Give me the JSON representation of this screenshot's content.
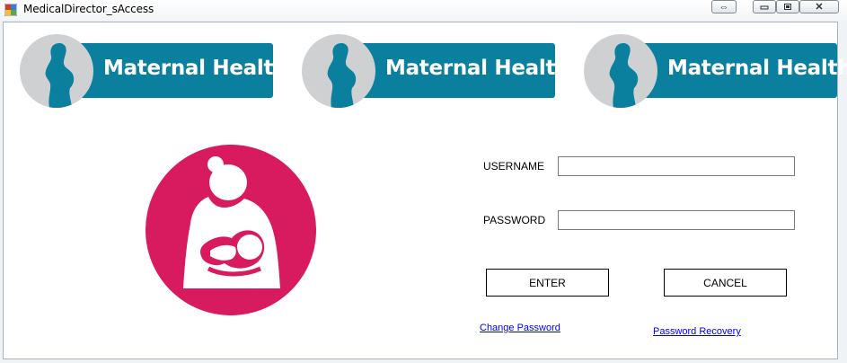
{
  "window": {
    "title": "MedicalDirector_sAccess",
    "controls": {
      "move_icon": "move-arrows-icon",
      "minimize_icon": "minimize-icon",
      "restore_icon": "restore-icon",
      "close_icon": "close-icon"
    }
  },
  "banners": [
    {
      "label": "Maternal Health",
      "icon": "pregnant-woman-icon"
    },
    {
      "label": "Maternal Health",
      "icon": "pregnant-woman-icon"
    },
    {
      "label": "Maternal Health",
      "icon": "pregnant-woman-icon"
    }
  ],
  "logo": {
    "icon": "mother-holding-baby-icon",
    "color": "#d81b5e"
  },
  "form": {
    "username_label": "USERNAME",
    "username_value": "",
    "password_label": "PASSWORD",
    "password_value": "",
    "enter_label": "ENTER",
    "cancel_label": "CANCEL",
    "change_password_link": "Change Password",
    "password_recovery_link": "Password Recovery"
  },
  "colors": {
    "banner": "#0a809e",
    "logo": "#d81b5e",
    "link": "#0000ee"
  }
}
